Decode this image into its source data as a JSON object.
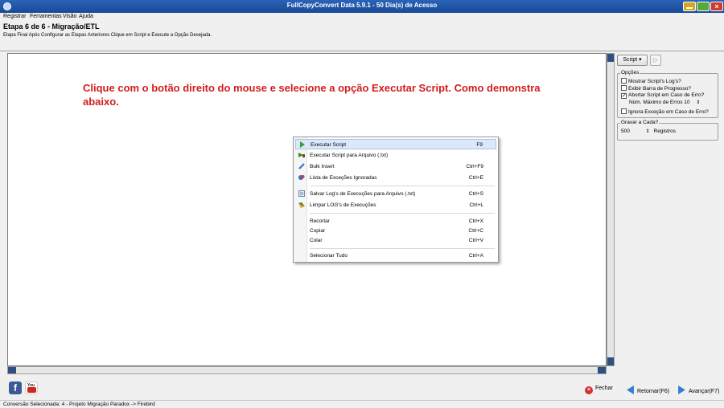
{
  "window": {
    "title": "FullCopyConvert Data 5.9.1 - 50 Dia(s) de Acesso"
  },
  "menu": [
    "Registrar",
    "Ferramentas",
    "Visão",
    "Ajuda"
  ],
  "header": {
    "step_title": "Etapa 6 de 6 - Migração/ETL",
    "step_description": "Etapa Final Após Configurar as Etapas Anteriores Clique em Script e Execute a Opção Desejada."
  },
  "editor": {
    "instruction": "Clique com o botão direito do mouse e selecione a opção Executar Script. Como demonstra abaixo."
  },
  "context_menu": {
    "items": [
      {
        "label": "Executar Script",
        "shortcut": "F9",
        "icon": "play-icon"
      },
      {
        "label": "Executar Script para Arquivo (.txt)",
        "shortcut": "",
        "icon": "run-to-file-icon"
      },
      {
        "label": "Bulk Insert",
        "shortcut": "Ctrl+F9",
        "icon": "bulk-insert-icon"
      },
      {
        "label": "Lista de Exceções Ignoradas",
        "shortcut": "Ctrl+E",
        "icon": "exceptions-icon"
      },
      {
        "label": "Salvar Log's de Execuções para Arquivo (.txt)",
        "shortcut": "Ctrl+S",
        "icon": "save-log-icon"
      },
      {
        "label": "Limpar LOG's de Execuções",
        "shortcut": "Ctrl+L",
        "icon": "clear-log-icon"
      },
      {
        "label": "Recortar",
        "shortcut": "Ctrl+X",
        "icon": ""
      },
      {
        "label": "Copiar",
        "shortcut": "Ctrl+C",
        "icon": ""
      },
      {
        "label": "Colar",
        "shortcut": "Ctrl+V",
        "icon": ""
      },
      {
        "label": "Selecionar Tudo",
        "shortcut": "Ctrl+A",
        "icon": ""
      }
    ]
  },
  "right_panel": {
    "script_button": "Script",
    "options_label": "Opções",
    "options": [
      {
        "label": "Mostrar Script's Log's?",
        "checked": false
      },
      {
        "label": "Exibir Barra de Progresso?",
        "checked": false
      },
      {
        "label": "Abortar Script em Caso de Erro?",
        "checked": true
      }
    ],
    "max_errors_label": "Núm. Máximo de Erros",
    "max_errors_value": "10",
    "ignore_exception": {
      "label": "Ignora Exceção em Caso de Erro?",
      "checked": false
    },
    "save_every_label": "Gravar a Cada?",
    "save_every_value": "500",
    "save_every_unit": "Registros"
  },
  "footer": {
    "close": "Fechar",
    "back": "Retornar(F6)",
    "next": "Avançar(F7)",
    "youtube_text": "You"
  },
  "status": {
    "text": "Conversão Selecionada: 4 - Projeto Migração Paradox -> Firebird"
  },
  "colors": {
    "instruction": "#d21d1d",
    "titlebar": "#1f52a3",
    "menu_highlight": "#dce8f7"
  }
}
